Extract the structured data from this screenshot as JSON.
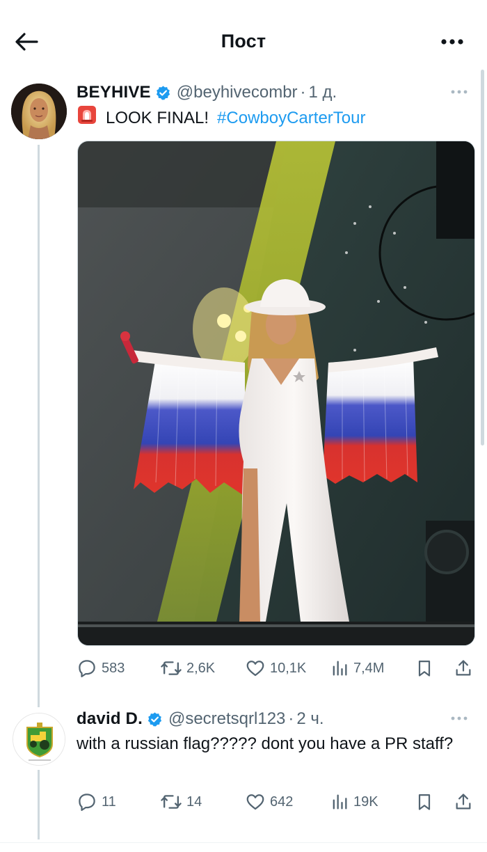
{
  "header": {
    "title": "Пост",
    "back_icon": "arrow-left-icon",
    "more_icon": "more-horizontal-icon"
  },
  "colors": {
    "accent": "#1d9bf0",
    "text": "#0f1419",
    "muted": "#536471",
    "line": "#cfd9de"
  },
  "posts": [
    {
      "author": "BEYHIVE",
      "verified": true,
      "handle": "@beyhivecombr",
      "separator": "·",
      "time": "1 д.",
      "text_icon": "siren-emoji-icon",
      "text": "LOOK FINAL!",
      "hashtag": "#CowboyCarterTour",
      "has_image": true,
      "stats": {
        "replies": "583",
        "reposts": "2,6K",
        "likes": "10,1K",
        "views": "7,4M"
      }
    },
    {
      "author": "david D.",
      "verified": true,
      "handle": "@secretsqrl123",
      "separator": "·",
      "time": "2 ч.",
      "text": "with a russian flag????? dont you have a PR staff?",
      "stats": {
        "replies": "11",
        "reposts": "14",
        "likes": "642",
        "views": "19K"
      }
    }
  ]
}
